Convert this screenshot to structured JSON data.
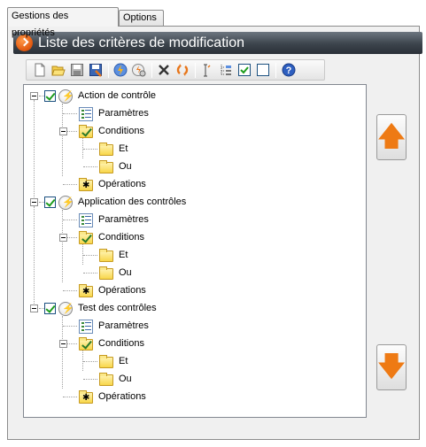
{
  "tabs": [
    {
      "label": "Gestions des propriétés",
      "active": true
    },
    {
      "label": "Options",
      "active": false
    }
  ],
  "header": {
    "title": "Liste des critères de modification"
  },
  "toolbar": {
    "icons": [
      "new-document-icon",
      "open-folder-icon",
      "save-icon",
      "save-as-icon",
      "lightning-action-icon",
      "lightning-settings-icon",
      "delete-icon",
      "refresh-icon",
      "insert-parameter-icon",
      "tree-structure-icon",
      "check-all-icon",
      "uncheck-all-icon",
      "help-icon"
    ]
  },
  "tree": {
    "groups": [
      {
        "label": "Action de contrôle",
        "checked": true,
        "children": {
          "parametres": "Paramètres",
          "conditions": "Conditions",
          "et": "Et",
          "ou": "Ou",
          "operations": "Opérations"
        }
      },
      {
        "label": "Application des contrôles",
        "checked": true,
        "children": {
          "parametres": "Paramètres",
          "conditions": "Conditions",
          "et": "Et",
          "ou": "Ou",
          "operations": "Opérations"
        }
      },
      {
        "label": "Test des contrôles",
        "checked": true,
        "children": {
          "parametres": "Paramètres",
          "conditions": "Conditions",
          "et": "Et",
          "ou": "Ou",
          "operations": "Opérations"
        }
      }
    ]
  },
  "colors": {
    "accent": "#ee7a14",
    "header_bg": "#3c444c",
    "check": "#1d9d1d"
  }
}
